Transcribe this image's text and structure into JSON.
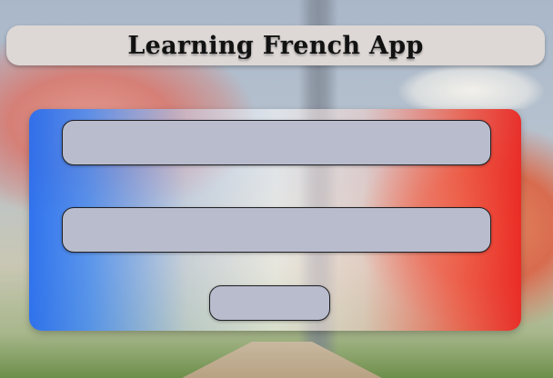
{
  "app": {
    "title": "Learning French App"
  },
  "form": {
    "field_1": {
      "value": "",
      "placeholder": ""
    },
    "field_2": {
      "value": "",
      "placeholder": ""
    },
    "submit_label": ""
  },
  "colors": {
    "title_bar": "#ddd8d6",
    "field_fill": "#b8bccc",
    "flag_blue": "#286ef0",
    "flag_red": "#eb2823"
  }
}
